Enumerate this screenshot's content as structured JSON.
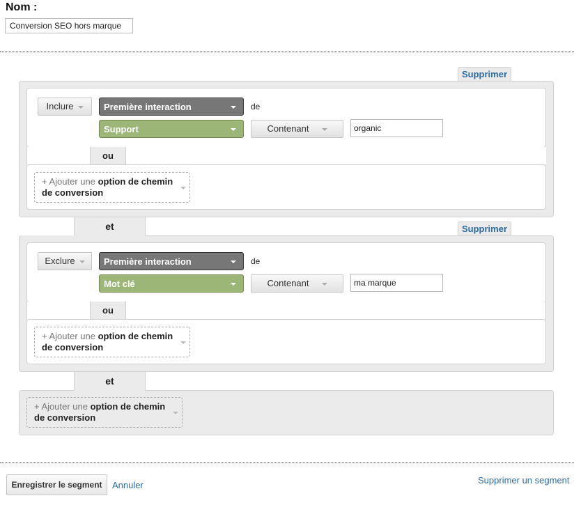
{
  "name_field": {
    "label": "Nom :",
    "value": "Conversion SEO hors marque"
  },
  "conditions": [
    {
      "delete_label": "Supprimer",
      "mode": "Inclure",
      "interaction": "Première interaction",
      "of_label": "de",
      "dimension": "Support",
      "operator": "Contenant",
      "value": "organic",
      "or_label": "ou",
      "add_option": {
        "prefix": "+ Ajouter une",
        "bold": "option de chemin",
        "bold2": "de conversion"
      }
    },
    {
      "delete_label": "Supprimer",
      "mode": "Exclure",
      "interaction": "Première interaction",
      "of_label": "de",
      "dimension": "Mot clé",
      "operator": "Contenant",
      "value": "ma marque",
      "or_label": "ou",
      "add_option": {
        "prefix": "+ Ajouter une",
        "bold": "option de chemin",
        "bold2": "de conversion"
      }
    }
  ],
  "and_label": "et",
  "final_add_option": {
    "prefix": "+ Ajouter une",
    "bold": "option de chemin",
    "bold2": "de conversion"
  },
  "footer": {
    "save_label": "Enregistrer le segment",
    "cancel_label": "Annuler",
    "delete_segment_label": "Supprimer un segment"
  },
  "colors": {
    "link": "#2b6ca3",
    "interaction_select": "#777777",
    "dimension_select": "#9bb676"
  }
}
